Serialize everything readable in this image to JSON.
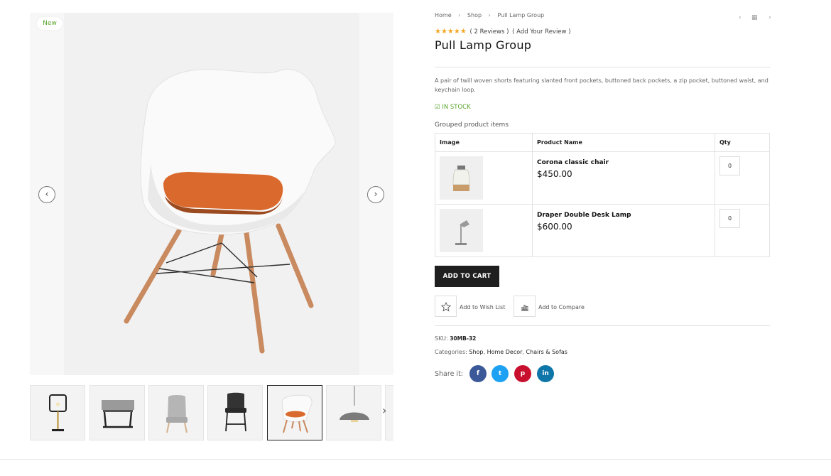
{
  "gallery": {
    "badge": "New",
    "prev_icon": "‹",
    "next_icon": "›",
    "thumb_next_icon": "›",
    "thumbnails": [
      "desk-lamp",
      "side-table",
      "grey-chair",
      "bar-stool",
      "white-chair",
      "pendant-lamp"
    ]
  },
  "breadcrumb": {
    "home": "Home",
    "shop": "Shop",
    "current": "Pull Lamp Group",
    "sep": "›"
  },
  "nav_tools": {
    "prev": "‹",
    "grid": "▦",
    "next": "›"
  },
  "rating": {
    "stars": "★★★★★",
    "reviews": "( 2  Reviews )",
    "add_review": "( Add Your Review )"
  },
  "product": {
    "title": "Pull Lamp Group",
    "description": "A pair of twill woven shorts featuring slanted front pockets, buttoned back pockets, a zip pocket, buttoned waist, and keychain loop.",
    "stock": "IN STOCK",
    "grouped_label": "Grouped product items",
    "table_headers": {
      "image": "Image",
      "name": "Product Name",
      "qty": "Qty"
    },
    "items": [
      {
        "name": "Corona classic chair",
        "price": "$450.00",
        "qty": "0"
      },
      {
        "name": "Draper Double Desk Lamp",
        "price": "$600.00",
        "qty": "0"
      }
    ],
    "add_to_cart": "ADD TO CART",
    "wishlist": "Add to Wish List",
    "compare": "Add to Compare",
    "sku_label": "SKU:",
    "sku": "30MB-32",
    "categories_label": "Categories:",
    "categories": [
      "Shop",
      "Home Decor",
      "Chairs & Sofas"
    ],
    "category_sep": ", ",
    "share_label": "Share it:",
    "social": {
      "facebook": "f",
      "twitter": "t",
      "pinterest": "p",
      "linkedin": "in"
    }
  },
  "colors": {
    "accent_green": "#5aa52d",
    "star": "#f5a623",
    "button_dark": "#1f1f1f",
    "cushion": "#d9692c",
    "facebook": "#3b5998",
    "twitter": "#1da1f2",
    "pinterest": "#c8102e",
    "linkedin": "#0e76a8"
  }
}
